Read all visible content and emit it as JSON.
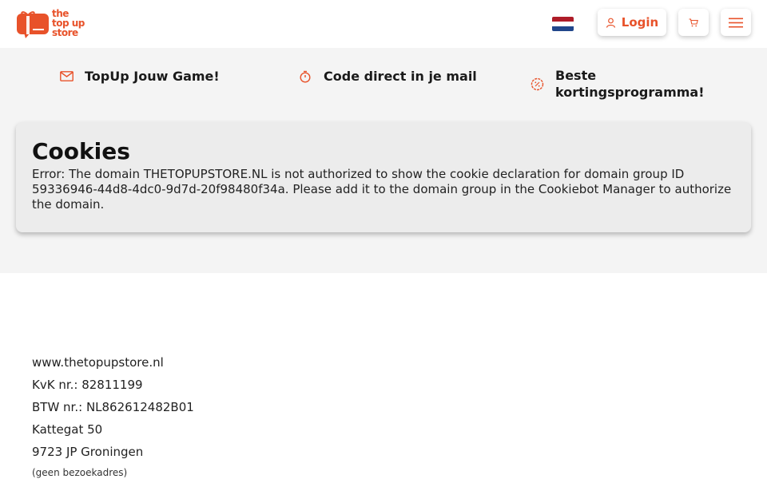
{
  "brand": {
    "logo_lines": [
      "the",
      "top up",
      "store"
    ],
    "color": "#e8522a"
  },
  "header": {
    "language_flag": "netherlands-flag",
    "login_label": "Login",
    "icons": [
      "user-icon",
      "cart-icon",
      "menu-icon"
    ]
  },
  "usps": [
    {
      "icon": "mail-icon",
      "label": "TopUp Jouw Game!"
    },
    {
      "icon": "stopwatch-icon",
      "label": "Code direct in je mail"
    },
    {
      "icon": "discount-badge-icon",
      "label": "Beste kortingsprogramma!"
    }
  ],
  "cookies": {
    "title": "Cookies",
    "message": "Error: The domain THETOPUPSTORE.NL is not authorized to show the cookie declaration for domain group ID 59336946-44d8-4dc0-9d7d-20f98480f34a. Please add it to the domain group in the Cookiebot Manager to authorize the domain."
  },
  "company": {
    "website": "www.thetopupstore.nl",
    "kvk": "KvK nr.: 82811199",
    "btw": "BTW nr.: NL862612482B01",
    "street": "Kattegat 50",
    "city": "9723 JP Groningen",
    "note": "(geen bezoekadres)"
  },
  "colors": {
    "accent": "#e8522a",
    "band_bg": "#f4f4f4",
    "card_bg": "#ececec"
  }
}
